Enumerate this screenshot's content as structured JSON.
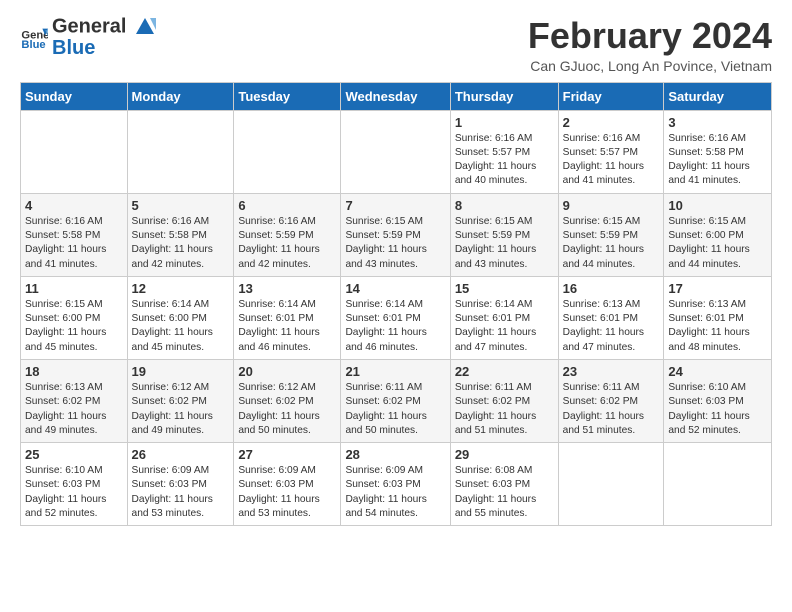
{
  "header": {
    "logo_general": "General",
    "logo_blue": "Blue",
    "month_year": "February 2024",
    "location": "Can GJuoc, Long An Povince, Vietnam"
  },
  "days_of_week": [
    "Sunday",
    "Monday",
    "Tuesday",
    "Wednesday",
    "Thursday",
    "Friday",
    "Saturday"
  ],
  "weeks": [
    [
      {
        "day": "",
        "info": ""
      },
      {
        "day": "",
        "info": ""
      },
      {
        "day": "",
        "info": ""
      },
      {
        "day": "",
        "info": ""
      },
      {
        "day": "1",
        "info": "Sunrise: 6:16 AM\nSunset: 5:57 PM\nDaylight: 11 hours\nand 40 minutes."
      },
      {
        "day": "2",
        "info": "Sunrise: 6:16 AM\nSunset: 5:57 PM\nDaylight: 11 hours\nand 41 minutes."
      },
      {
        "day": "3",
        "info": "Sunrise: 6:16 AM\nSunset: 5:58 PM\nDaylight: 11 hours\nand 41 minutes."
      }
    ],
    [
      {
        "day": "4",
        "info": "Sunrise: 6:16 AM\nSunset: 5:58 PM\nDaylight: 11 hours\nand 41 minutes."
      },
      {
        "day": "5",
        "info": "Sunrise: 6:16 AM\nSunset: 5:58 PM\nDaylight: 11 hours\nand 42 minutes."
      },
      {
        "day": "6",
        "info": "Sunrise: 6:16 AM\nSunset: 5:59 PM\nDaylight: 11 hours\nand 42 minutes."
      },
      {
        "day": "7",
        "info": "Sunrise: 6:15 AM\nSunset: 5:59 PM\nDaylight: 11 hours\nand 43 minutes."
      },
      {
        "day": "8",
        "info": "Sunrise: 6:15 AM\nSunset: 5:59 PM\nDaylight: 11 hours\nand 43 minutes."
      },
      {
        "day": "9",
        "info": "Sunrise: 6:15 AM\nSunset: 5:59 PM\nDaylight: 11 hours\nand 44 minutes."
      },
      {
        "day": "10",
        "info": "Sunrise: 6:15 AM\nSunset: 6:00 PM\nDaylight: 11 hours\nand 44 minutes."
      }
    ],
    [
      {
        "day": "11",
        "info": "Sunrise: 6:15 AM\nSunset: 6:00 PM\nDaylight: 11 hours\nand 45 minutes."
      },
      {
        "day": "12",
        "info": "Sunrise: 6:14 AM\nSunset: 6:00 PM\nDaylight: 11 hours\nand 45 minutes."
      },
      {
        "day": "13",
        "info": "Sunrise: 6:14 AM\nSunset: 6:01 PM\nDaylight: 11 hours\nand 46 minutes."
      },
      {
        "day": "14",
        "info": "Sunrise: 6:14 AM\nSunset: 6:01 PM\nDaylight: 11 hours\nand 46 minutes."
      },
      {
        "day": "15",
        "info": "Sunrise: 6:14 AM\nSunset: 6:01 PM\nDaylight: 11 hours\nand 47 minutes."
      },
      {
        "day": "16",
        "info": "Sunrise: 6:13 AM\nSunset: 6:01 PM\nDaylight: 11 hours\nand 47 minutes."
      },
      {
        "day": "17",
        "info": "Sunrise: 6:13 AM\nSunset: 6:01 PM\nDaylight: 11 hours\nand 48 minutes."
      }
    ],
    [
      {
        "day": "18",
        "info": "Sunrise: 6:13 AM\nSunset: 6:02 PM\nDaylight: 11 hours\nand 49 minutes."
      },
      {
        "day": "19",
        "info": "Sunrise: 6:12 AM\nSunset: 6:02 PM\nDaylight: 11 hours\nand 49 minutes."
      },
      {
        "day": "20",
        "info": "Sunrise: 6:12 AM\nSunset: 6:02 PM\nDaylight: 11 hours\nand 50 minutes."
      },
      {
        "day": "21",
        "info": "Sunrise: 6:11 AM\nSunset: 6:02 PM\nDaylight: 11 hours\nand 50 minutes."
      },
      {
        "day": "22",
        "info": "Sunrise: 6:11 AM\nSunset: 6:02 PM\nDaylight: 11 hours\nand 51 minutes."
      },
      {
        "day": "23",
        "info": "Sunrise: 6:11 AM\nSunset: 6:02 PM\nDaylight: 11 hours\nand 51 minutes."
      },
      {
        "day": "24",
        "info": "Sunrise: 6:10 AM\nSunset: 6:03 PM\nDaylight: 11 hours\nand 52 minutes."
      }
    ],
    [
      {
        "day": "25",
        "info": "Sunrise: 6:10 AM\nSunset: 6:03 PM\nDaylight: 11 hours\nand 52 minutes."
      },
      {
        "day": "26",
        "info": "Sunrise: 6:09 AM\nSunset: 6:03 PM\nDaylight: 11 hours\nand 53 minutes."
      },
      {
        "day": "27",
        "info": "Sunrise: 6:09 AM\nSunset: 6:03 PM\nDaylight: 11 hours\nand 53 minutes."
      },
      {
        "day": "28",
        "info": "Sunrise: 6:09 AM\nSunset: 6:03 PM\nDaylight: 11 hours\nand 54 minutes."
      },
      {
        "day": "29",
        "info": "Sunrise: 6:08 AM\nSunset: 6:03 PM\nDaylight: 11 hours\nand 55 minutes."
      },
      {
        "day": "",
        "info": ""
      },
      {
        "day": "",
        "info": ""
      }
    ]
  ]
}
